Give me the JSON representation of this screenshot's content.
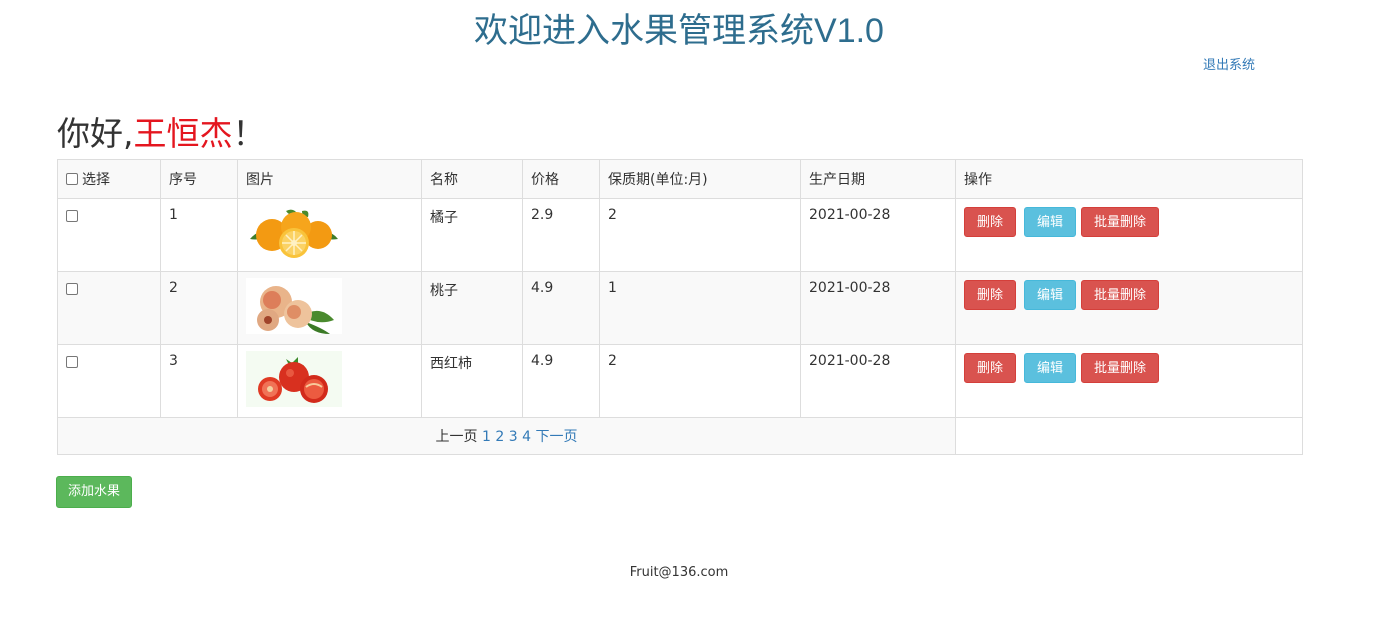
{
  "header": {
    "title": "欢迎进入水果管理系统V1.0",
    "logout_label": "退出系统"
  },
  "greeting": {
    "prefix": "你好,",
    "username": "王恒杰",
    "suffix": "！"
  },
  "table": {
    "columns": [
      "选择",
      "序号",
      "图片",
      "名称",
      "价格",
      "保质期(单位:月)",
      "生产日期",
      "操作"
    ],
    "rows": [
      {
        "index": "1",
        "name": "橘子",
        "price": "2.9",
        "shelf_life": "2",
        "date": "2021-00-28",
        "image": "orange-image"
      },
      {
        "index": "2",
        "name": "桃子",
        "price": "4.9",
        "shelf_life": "1",
        "date": "2021-00-28",
        "image": "peach-image"
      },
      {
        "index": "3",
        "name": "西红柿",
        "price": "4.9",
        "shelf_life": "2",
        "date": "2021-00-28",
        "image": "tomato-image"
      }
    ],
    "actions": {
      "delete": "删除",
      "edit": "编辑",
      "batch_delete": "批量删除"
    }
  },
  "pager": {
    "prev": "上一页",
    "pages": [
      "1",
      "2",
      "3",
      "4"
    ],
    "next": "下一页"
  },
  "add_button": "添加水果",
  "footer": "Fruit@136.com",
  "colors": {
    "title": "#2e6d8e",
    "username": "#e4161f",
    "danger": "#d9534f",
    "info": "#5bc0de",
    "success": "#5cb85c",
    "link": "#337ab7"
  }
}
